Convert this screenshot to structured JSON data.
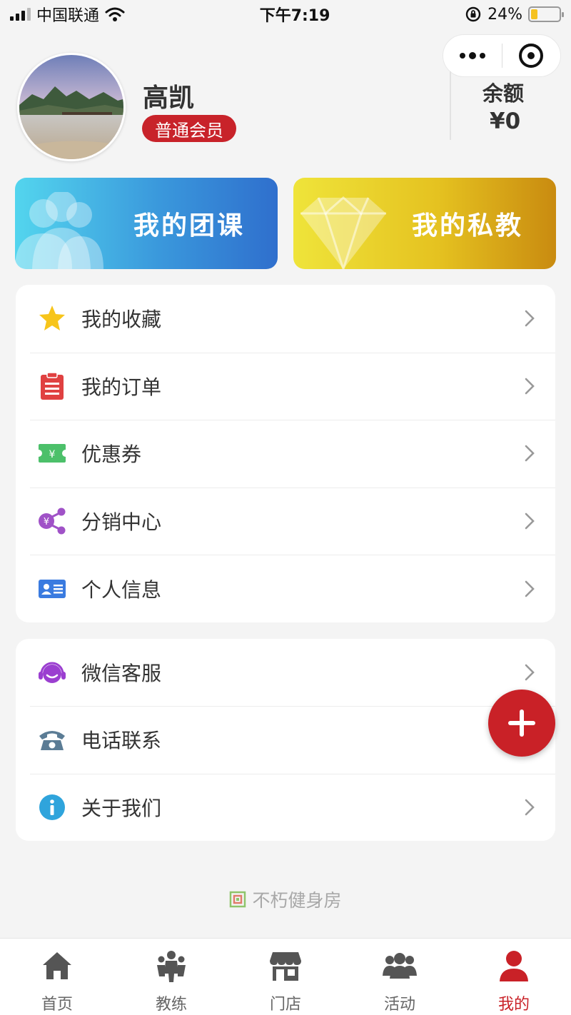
{
  "status_bar": {
    "carrier": "中国联通",
    "time": "下午7:19",
    "battery": "24%",
    "battery_level": 0.24
  },
  "profile": {
    "name": "高凯",
    "member_level": "普通会员",
    "balance_label": "余额",
    "balance_value": "¥0"
  },
  "cards": {
    "group_class": "我的团课",
    "private_coach": "我的私教"
  },
  "menu_main": [
    {
      "label": "我的收藏",
      "icon": "star-icon"
    },
    {
      "label": "我的订单",
      "icon": "clipboard-icon"
    },
    {
      "label": "优惠券",
      "icon": "coupon-icon"
    },
    {
      "label": "分销中心",
      "icon": "share-icon"
    },
    {
      "label": "个人信息",
      "icon": "id-card-icon"
    }
  ],
  "menu_support": [
    {
      "label": "微信客服",
      "icon": "headset-icon"
    },
    {
      "label": "电话联系",
      "icon": "phone-icon"
    },
    {
      "label": "关于我们",
      "icon": "info-icon"
    }
  ],
  "footer": {
    "brand": "不朽健身房"
  },
  "tabbar": [
    {
      "label": "首页",
      "icon": "home-icon"
    },
    {
      "label": "教练",
      "icon": "coach-icon"
    },
    {
      "label": "门店",
      "icon": "store-icon"
    },
    {
      "label": "活动",
      "icon": "group-icon"
    },
    {
      "label": "我的",
      "icon": "user-icon",
      "active": true
    }
  ],
  "colors": {
    "accent": "#c92127",
    "badge": "#c8232a",
    "background": "#f4f4f4"
  }
}
